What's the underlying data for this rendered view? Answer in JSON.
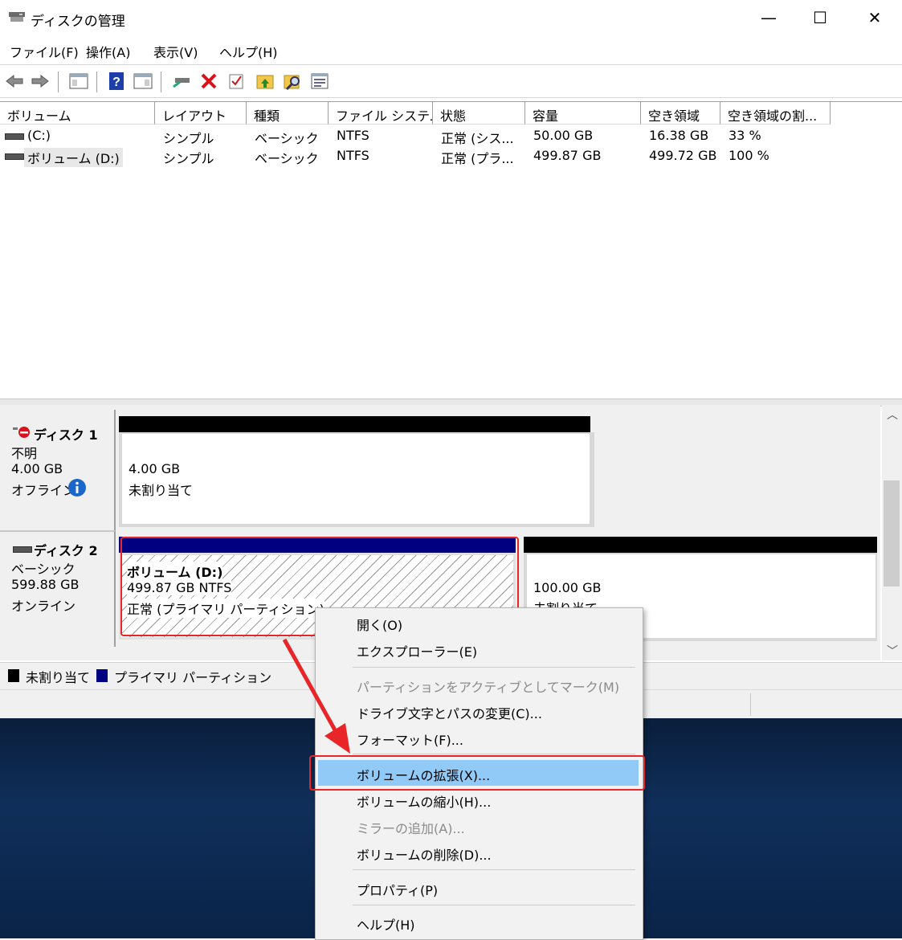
{
  "window": {
    "title": "ディスクの管理",
    "minimize": "—",
    "maximize": "☐",
    "close": "✕"
  },
  "menu": [
    "ファイル(F)",
    "操作(A)",
    "表示(V)",
    "ヘルプ(H)"
  ],
  "toolbar_icons": [
    "back-arrow-icon",
    "forward-arrow-icon",
    "console-tree-icon",
    "help-icon",
    "action-pane-icon",
    "connect-disk-icon",
    "delete-icon",
    "check-icon",
    "folder-up-icon",
    "folder-search-icon",
    "properties-icon"
  ],
  "columns": [
    "ボリューム",
    "レイアウト",
    "種類",
    "ファイル システム",
    "状態",
    "容量",
    "空き領域",
    "空き領域の割..."
  ],
  "volumes": [
    [
      "(C:)",
      "シンプル",
      "ベーシック",
      "NTFS",
      "正常 (シス...",
      "50.00 GB",
      "16.38 GB",
      "33 %"
    ],
    [
      "ボリューム (D:)",
      "シンプル",
      "ベーシック",
      "NTFS",
      "正常 (プラ...",
      "499.87 GB",
      "499.72 GB",
      "100 %"
    ]
  ],
  "disks": [
    {
      "name": "ディスク 1",
      "type": "不明",
      "size": "4.00 GB",
      "status": "オフライン",
      "partitions": [
        {
          "line1": "4.00 GB",
          "line2": "未割り当て"
        }
      ]
    },
    {
      "name": "ディスク 2",
      "type": "ベーシック",
      "size": "599.88 GB",
      "status": "オンライン",
      "partitions": [
        {
          "line1": "ボリューム  (D:)",
          "line2": "499.87 GB NTFS",
          "line3": "正常 (プライマリ パーティション)"
        },
        {
          "line1": "100.00 GB",
          "line2": "未割り当て"
        }
      ]
    }
  ],
  "legend": [
    "未割り当て",
    "プライマリ パーティション"
  ],
  "colors": {
    "unallocated": "#000000",
    "primary": "#000080",
    "highlight": "#91c9f7",
    "annotation": "#e8262a"
  },
  "context_menu": [
    {
      "label": "開く(O)",
      "enabled": true
    },
    {
      "label": "エクスプローラー(E)",
      "enabled": true
    },
    {
      "label": "パーティションをアクティブとしてマーク(M)",
      "enabled": false
    },
    {
      "label": "ドライブ文字とパスの変更(C)...",
      "enabled": true
    },
    {
      "label": "フォーマット(F)...",
      "enabled": true
    },
    {
      "label": "ボリュームの拡張(X)...",
      "enabled": true,
      "highlighted": true
    },
    {
      "label": "ボリュームの縮小(H)...",
      "enabled": true
    },
    {
      "label": "ミラーの追加(A)...",
      "enabled": false
    },
    {
      "label": "ボリュームの削除(D)...",
      "enabled": true
    },
    {
      "label": "プロパティ(P)",
      "enabled": true
    },
    {
      "label": "ヘルプ(H)",
      "enabled": true
    }
  ]
}
